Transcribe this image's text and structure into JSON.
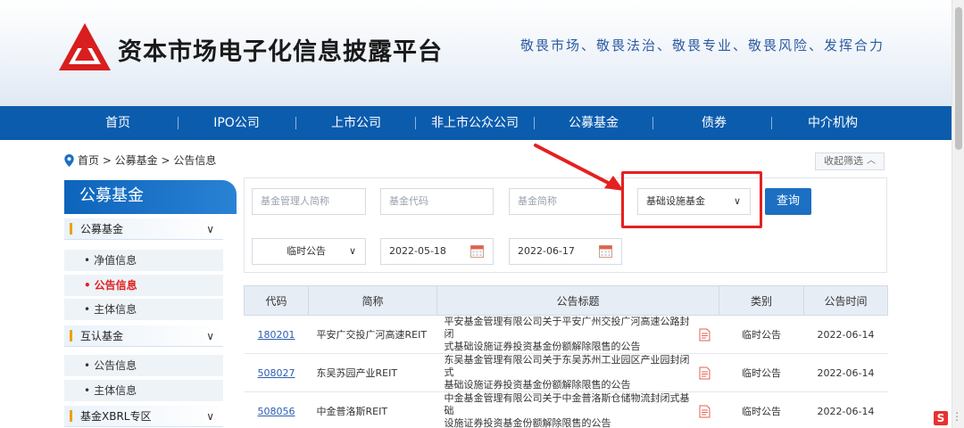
{
  "header": {
    "site_title": "资本市场电子化信息披露平台",
    "slogan": "敬畏市场、敬畏法治、敬畏专业、敬畏风险、发挥合力",
    "logo_icon": "red-triangle-logo"
  },
  "nav": {
    "items": [
      "首页",
      "IPO公司",
      "上市公司",
      "非上市公众公司",
      "公募基金",
      "债券",
      "中介机构"
    ]
  },
  "breadcrumb": {
    "icon": "location-pin-icon",
    "text": "首页 > 公募基金 > 公告信息"
  },
  "collapse_button": {
    "label": "收起筛选",
    "icon": "chevron-up-icon"
  },
  "sidebar": {
    "title": "公募基金",
    "groups": [
      {
        "label": "公募基金",
        "items": [
          {
            "label": "净值信息",
            "active": false
          },
          {
            "label": "公告信息",
            "active": true
          },
          {
            "label": "主体信息",
            "active": false
          }
        ]
      },
      {
        "label": "互认基金",
        "items": [
          {
            "label": "公告信息",
            "active": false
          },
          {
            "label": "主体信息",
            "active": false
          }
        ]
      },
      {
        "label": "基金XBRL专区",
        "items": []
      }
    ]
  },
  "filters": {
    "manager_placeholder": "基金管理人简称",
    "code_placeholder": "基金代码",
    "short_name_placeholder": "基金简称",
    "fund_type_selected": "基础设施基金",
    "query_label": "查询",
    "announcement_type_selected": "临时公告",
    "start_date": "2022-05-18",
    "end_date": "2022-06-17"
  },
  "table": {
    "headers": [
      "代码",
      "简称",
      "公告标题",
      "类别",
      "公告时间"
    ],
    "rows": [
      {
        "code": "180201",
        "name": "平安广交投广河高速REIT",
        "title_line1": "平安基金管理有限公司关于平安广州交投广河高速公路封闭",
        "title_line2": "式基础设施证券投资基金份额解除限售的公告",
        "category": "临时公告",
        "date": "2022-06-14"
      },
      {
        "code": "508027",
        "name": "东吴苏园产业REIT",
        "title_line1": "东吴基金管理有限公司关于东吴苏州工业园区产业园封闭式",
        "title_line2": "基础设施证券投资基金份额解除限售的公告",
        "category": "临时公告",
        "date": "2022-06-14"
      },
      {
        "code": "508056",
        "name": "中金普洛斯REIT",
        "title_line1": "中金基金管理有限公司关于中金普洛斯仓储物流封闭式基础",
        "title_line2": "设施证券投资基金份额解除限售的公告",
        "category": "临时公告",
        "date": "2022-06-14"
      }
    ]
  },
  "colors": {
    "nav_blue": "#0b5cad",
    "accent_red": "#e02020",
    "link_blue": "#2a5db0"
  }
}
